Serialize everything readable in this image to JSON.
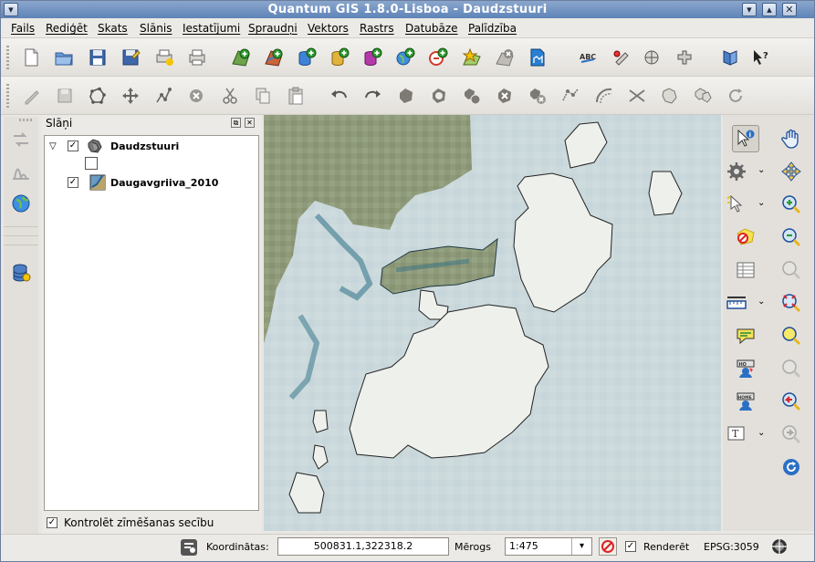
{
  "window": {
    "title": "Quantum GIS 1.8.0-Lisboa - Daudzstuuri",
    "menu_icon": "chevron-down-icon",
    "controls": [
      "minimize-icon",
      "maximize-icon",
      "close-icon"
    ]
  },
  "menubar": {
    "items": [
      "Fails",
      "Rediģēt",
      "Skats",
      "Slānis",
      "Iestatījumi",
      "Spraudņi",
      "Vektors",
      "Rastrs",
      "Datubāze",
      "Palīdzība"
    ]
  },
  "layers_panel": {
    "title": "Slāņi",
    "group": {
      "name": "Daudzstuuri",
      "checked": true,
      "expanded": true
    },
    "layers": [
      {
        "name": "Daugavgriiva_2010",
        "checked": true,
        "type": "raster"
      }
    ],
    "render_order_label": "Kontrolēt zīmēšanas secību",
    "render_order_checked": true
  },
  "statusbar": {
    "coords_label": "Koordinātas:",
    "coords_value": "500831.1,322318.2",
    "scale_label": "Mērogs",
    "scale_value": "1:475",
    "render_label": "Renderēt",
    "render_checked": true,
    "crs": "EPSG:3059"
  },
  "colors": {
    "titlebar": "#6f91c2",
    "water": "#cbd9dc",
    "land": "#8f9c7c",
    "island_fill": "#f2f2ef",
    "accent": "#2b6fc4"
  }
}
